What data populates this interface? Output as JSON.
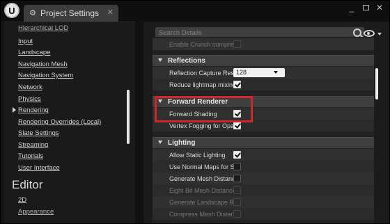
{
  "window": {
    "logo": "U",
    "tab": {
      "icon": "gear-icon",
      "title": "Project Settings"
    },
    "controls": [
      "minimize-icon",
      "maximize-icon",
      "close-icon"
    ]
  },
  "left": {
    "items": [
      {
        "label": "Hierarchical LOD",
        "clipped": true
      },
      {
        "label": "Input"
      },
      {
        "label": "Landscape"
      },
      {
        "label": "Navigation Mesh"
      },
      {
        "label": "Navigation System"
      },
      {
        "label": "Network"
      },
      {
        "label": "Physics"
      },
      {
        "label": "Rendering",
        "selected": true
      },
      {
        "label": "Rendering Overrides (Local)"
      },
      {
        "label": "Slate Settings"
      },
      {
        "label": "Streaming"
      },
      {
        "label": "Tutorials"
      },
      {
        "label": "User Interface"
      }
    ],
    "section": "Editor",
    "editor_items": [
      {
        "label": "2D"
      },
      {
        "label": "Appearance",
        "clipped": true
      }
    ]
  },
  "right": {
    "search_placeholder": "Search Details",
    "rows_top": [
      {
        "label": "Enable Crunch compressi",
        "checked": false,
        "dim": true
      }
    ],
    "reflections": {
      "title": "Reflections",
      "rows": [
        {
          "label": "Reflection Capture Resolu",
          "value": "128"
        },
        {
          "label": "Reduce lightmap mixing o",
          "checked": true
        }
      ]
    },
    "forward": {
      "title": "Forward Renderer",
      "rows": [
        {
          "label": "Forward Shading",
          "checked": true
        },
        {
          "label": "Vertex Fogging for Opaque",
          "checked": true
        }
      ]
    },
    "lighting": {
      "title": "Lighting",
      "rows": [
        {
          "label": "Allow Static Lighting",
          "checked": true
        },
        {
          "label": "Use Normal Maps for Stat",
          "checked": false
        },
        {
          "label": "Generate Mesh Distance F",
          "checked": false
        },
        {
          "label": "Eight Bit Mesh Distance F",
          "checked": false,
          "dim": true
        },
        {
          "label": "Generate Landscape Real-",
          "checked": false,
          "dim": true
        },
        {
          "label": "Compress Mesh Distance",
          "checked": false,
          "dim": true
        }
      ]
    }
  },
  "colors": {
    "highlight": "#d3262c",
    "panel": "#1b1b1b",
    "row": "#303030",
    "header": "#3f3f3f"
  }
}
